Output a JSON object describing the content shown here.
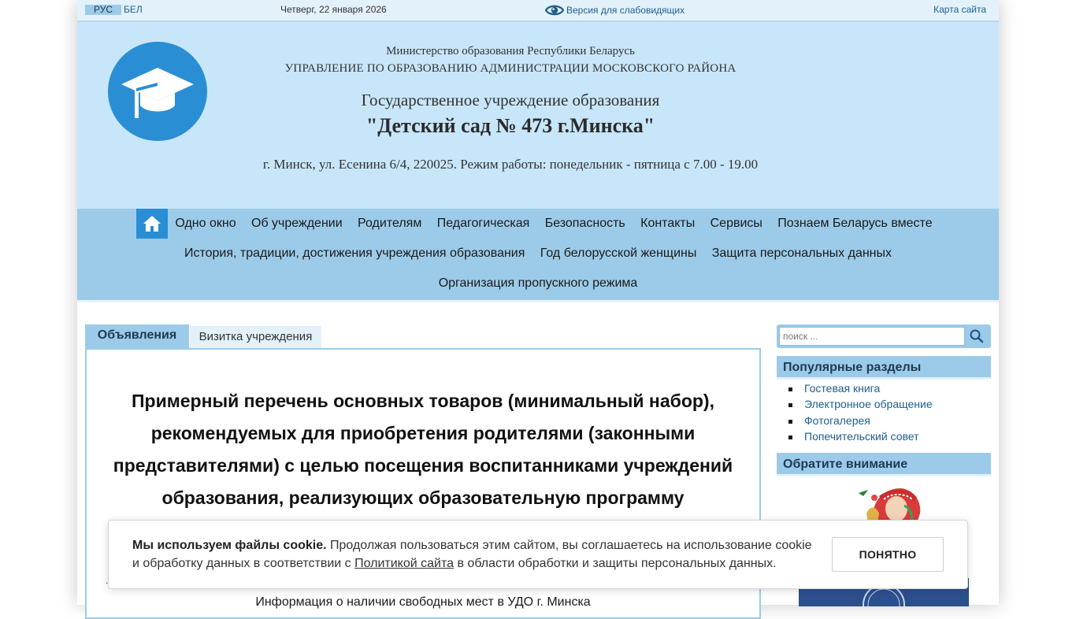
{
  "topbar": {
    "lang_ru": "РУС",
    "lang_be": "БЕЛ",
    "date": "Четверг, 22 января 2026",
    "vision_label": "Версия для слабовидящих",
    "sitemap": "Карта сайта"
  },
  "header": {
    "ministry": "Министерство образования Республики Беларусь",
    "department": "УПРАВЛЕНИЕ ПО ОБРАЗОВАНИЮ АДМИНИСТРАЦИИ МОСКОВСКОГО РАЙОНА",
    "institution_type": "Государственное учреждение образования",
    "institution_name": "\"Детский сад № 473 г.Минска\"",
    "address": "г. Минск, ул. Есенина 6/4, 220025. Режим работы: понедельник - пятница с 7.00 - 19.00"
  },
  "nav": {
    "row1": [
      "Одно окно",
      "Об учреждении",
      "Родителям",
      "Педагогическая",
      "Безопасность",
      "Контакты",
      "Сервисы",
      "Познаем Беларусь вместе"
    ],
    "row2": [
      "История, традиции, достижения учреждения образования",
      "Год белорусской женщины",
      "Защита персональных данных"
    ],
    "row3": [
      "Организация пропускного режима"
    ]
  },
  "tabs": {
    "active": "Объявления",
    "inactive": "Визитка учреждения"
  },
  "article": {
    "title": "Примерный перечень основных товаров (минимальный набор), рекомендуемых для приобретения родителями (законными представителями) с целью посещения воспитанниками учреждений образования, реализующих образовательную программу",
    "dot": ".",
    "info_line": "Информация о наличии свободных мест в УДО г. Минска"
  },
  "sidebar": {
    "search_placeholder": "поиск ...",
    "popular_heading": "Популярные разделы",
    "popular_items": [
      "Гостевая книга",
      "Электронное обращение",
      "Фотогалерея",
      "Попечительский совет"
    ],
    "attention_heading": "Обратите внимание"
  },
  "cookie": {
    "bold": "Мы используем файлы cookie.",
    "text_before": " Продолжая пользоваться этим сайтом, вы соглашаетесь на использование cookie и обработку данных в соответствии с ",
    "link": "Политикой сайта",
    "text_after": " в области обработки и защиты персональных данных.",
    "button": "ПОНЯТНО"
  },
  "colors": {
    "header_bg": "#c8e6fa",
    "nav_bg": "#9ccbe9",
    "accent_blue": "#2a8ed4",
    "link": "#1c5f8f"
  }
}
